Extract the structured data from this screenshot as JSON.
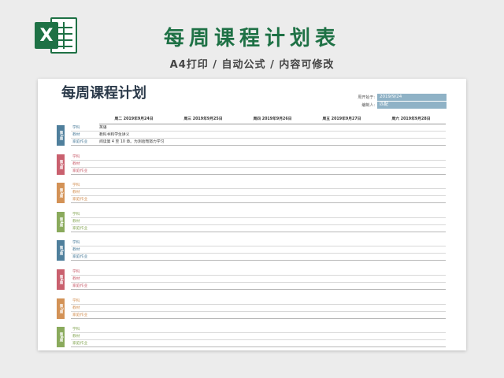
{
  "banner": {
    "title": "每周课程计划表",
    "subtitle": "A4打印 / 自动公式 / 内容可修改",
    "logo_letter": "X",
    "accent_color": "#1e7145"
  },
  "doc": {
    "title": "每周课程计划",
    "meta": [
      {
        "label": "周开始于:",
        "value": "2019/9/24"
      },
      {
        "label": "编制人:",
        "value": "匹配"
      }
    ],
    "days": [
      "周二 2019年9月24日",
      "周三 2019年9月25日",
      "周四 2019年9月26日",
      "周五 2019年9月27日",
      "周六 2019年9月28日"
    ],
    "weeks": [
      {
        "tab": "第1周",
        "color": "#4f7f9c",
        "rows": [
          {
            "label": "学科",
            "value": "英语"
          },
          {
            "label": "教材",
            "value": "教科书和学生讲义"
          },
          {
            "label": "家庭作业",
            "value": "阅读第 4 至 10 章。为测验而努力学习"
          }
        ]
      },
      {
        "tab": "第2周",
        "color": "#c9606e",
        "rows": [
          {
            "label": "学科",
            "value": ""
          },
          {
            "label": "教材",
            "value": ""
          },
          {
            "label": "家庭作业",
            "value": ""
          }
        ]
      },
      {
        "tab": "第3周",
        "color": "#d39256",
        "rows": [
          {
            "label": "学科",
            "value": ""
          },
          {
            "label": "教材",
            "value": ""
          },
          {
            "label": "家庭作业",
            "value": ""
          }
        ]
      },
      {
        "tab": "第4周",
        "color": "#8aaa5c",
        "rows": [
          {
            "label": "学科",
            "value": ""
          },
          {
            "label": "教材",
            "value": ""
          },
          {
            "label": "家庭作业",
            "value": ""
          }
        ]
      },
      {
        "tab": "第5周",
        "color": "#4f7f9c",
        "rows": [
          {
            "label": "学科",
            "value": ""
          },
          {
            "label": "教材",
            "value": ""
          },
          {
            "label": "家庭作业",
            "value": ""
          }
        ]
      },
      {
        "tab": "第6周",
        "color": "#c9606e",
        "rows": [
          {
            "label": "学科",
            "value": ""
          },
          {
            "label": "教材",
            "value": ""
          },
          {
            "label": "家庭作业",
            "value": ""
          }
        ]
      },
      {
        "tab": "第7周",
        "color": "#d39256",
        "rows": [
          {
            "label": "学科",
            "value": ""
          },
          {
            "label": "教材",
            "value": ""
          },
          {
            "label": "家庭作业",
            "value": ""
          }
        ]
      },
      {
        "tab": "第8周",
        "color": "#8aaa5c",
        "rows": [
          {
            "label": "学科",
            "value": ""
          },
          {
            "label": "教材",
            "value": ""
          },
          {
            "label": "家庭作业",
            "value": ""
          }
        ]
      }
    ]
  }
}
